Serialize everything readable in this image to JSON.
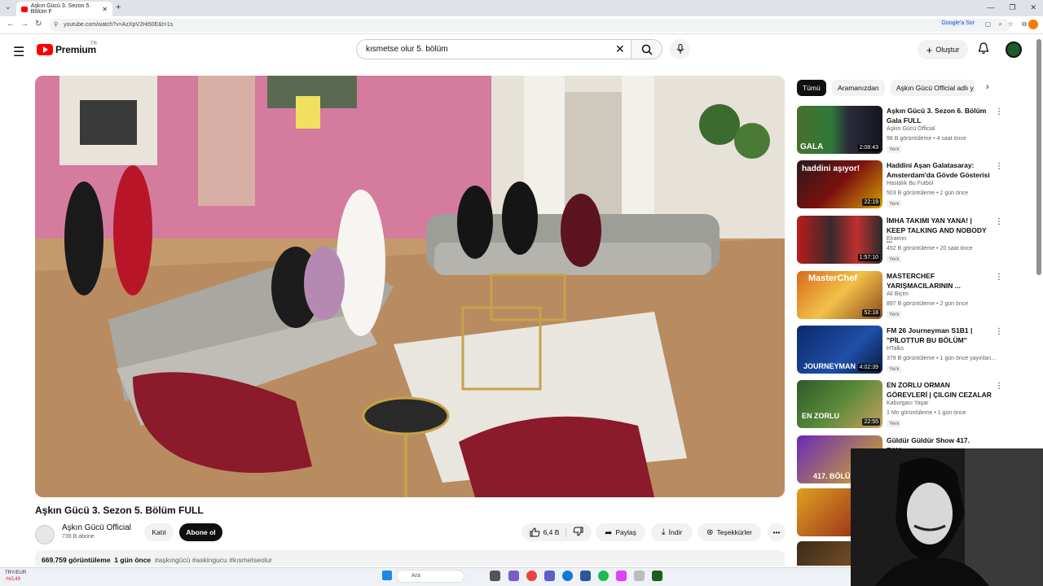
{
  "browser": {
    "tab_title": "Aşkın Gücü 3. Sezon 5. Bölüm F",
    "tab_close": "✕",
    "new_tab": "+",
    "url": "youtube.com/watch?v=AzXpV2Hi50E&t=1s",
    "google_sor": "Google'a Sor",
    "win_controls": [
      "—",
      "❐",
      "✕"
    ]
  },
  "header": {
    "logo_text": "Premium",
    "country": "TR",
    "search_value": "kısmetse olur 5. bölüm",
    "create_label": "Oluştur"
  },
  "video": {
    "title": "Aşkın Gücü 3. Sezon 5. Bölüm FULL",
    "channel": "Aşkın Gücü Official",
    "subscribers": "739 B abone",
    "join": "Katıl",
    "subscribe": "Abone ol",
    "likes": "6,4 B",
    "share": "Paylaş",
    "download": "İndir",
    "thanks": "Teşekkürler",
    "views": "669.759 görüntüleme",
    "age": "1 gün önce",
    "tags": "#aşkıngücü #askingucu #kısmetseolur"
  },
  "chips": [
    "Tümü",
    "Aramanızdan",
    "Aşkın Gücü Official adlı y"
  ],
  "recommendations": [
    {
      "title": "Aşkın Gücü 3. Sezon 6. Bölüm Gala FULL",
      "channel": "Aşkın Gücü Official",
      "meta": "98 B görüntüleme • 4 saat önce",
      "badge": "Yeni",
      "duration": "2:08:43",
      "thumb_text": "GALA"
    },
    {
      "title": "Haddini Aşan Galatasaray: Amsterdam'da Gövde Gösterisi",
      "channel": "Hastalık Bu Futbol",
      "meta": "503 B görüntüleme • 2 gün önce",
      "badge": "Yeni",
      "duration": "22:19",
      "thumb_text": "haddini aşıyor!"
    },
    {
      "title": "İMHA TAKIMI YAN YANA! | KEEP TALKING AND NOBODY ...",
      "channel": "Elraenn",
      "meta": "452 B görüntüleme • 20 saat önce",
      "badge": "Yeni",
      "duration": "1:57:10",
      "thumb_text": ""
    },
    {
      "title": "MASTERCHEF YARIŞMACILARININ ...",
      "channel": "Ali Biçim",
      "meta": "897 B görüntüleme • 2 gün önce",
      "badge": "Yeni",
      "duration": "52:18",
      "thumb_text": "MasterChef"
    },
    {
      "title": "FM 26 Journeyman S1B1 | \"PİLOTTUR BU BÖLÜM\"",
      "channel": "HTalks",
      "meta": "379 B görüntüleme • 1 gün önce yayınlan...",
      "badge": "Yeni",
      "duration": "4:02:39",
      "thumb_text": "JOURNEYMAN"
    },
    {
      "title": "EN ZORLU ORMAN GÖREVLERİ | ÇILGIN CEZALAR",
      "channel": "Kaburgacı Yaşar",
      "meta": "1 Mn görüntüleme • 1 gün önce",
      "badge": "Yeni",
      "duration": "22:55",
      "thumb_text": "EN ZORLU"
    },
    {
      "title": "Güldür Güldür Show 417. Bölüm",
      "channel": "",
      "meta": "",
      "badge": "",
      "duration": "",
      "thumb_text": "417. BÖLÜ"
    }
  ],
  "taskbar": {
    "currency": "TRY/EUR",
    "currency_change": "-%0,49",
    "search_placeholder": "Ara"
  },
  "colors": {
    "brand_red": "#ff0000",
    "chip_active": "#0f0f0f",
    "pill_bg": "#f2f2f2"
  }
}
